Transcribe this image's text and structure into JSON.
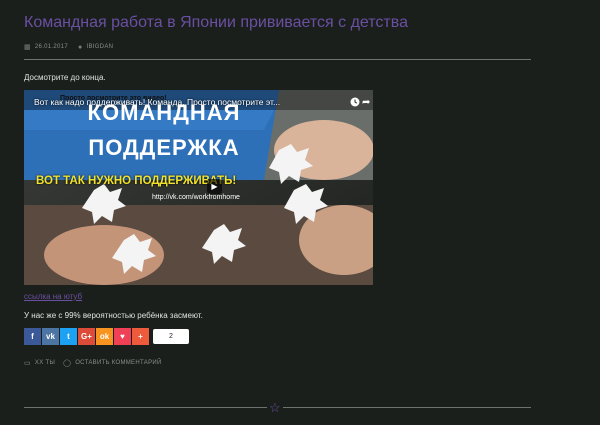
{
  "post": {
    "title": "Командная работа в Японии прививается с детства",
    "date": "26.01.2017",
    "author": "IBIGDAN",
    "intro": "Досмотрите до конца.",
    "link_text": "ссылка на ютуб",
    "stat_text": "У нас же с 99% вероятностью ребёнка засмеют.",
    "category": "ХХ ТЫ",
    "comment_link": "ОСТАВИТЬ КОММЕНТАРИЙ"
  },
  "video": {
    "title": "Вот как надо поддерживать! Команда. Просто посмотрите эт...",
    "overlay_small": "Просто посмотрите это видео!",
    "banner_line1": "КОМАНДНАЯ",
    "banner_line2": "ПОДДЕРЖКА",
    "yellow_line": "ВОТ ТАК НУЖНО ПОДДЕРЖИВАТЬ!",
    "url": "http://vk.com/workfromhome"
  },
  "share": {
    "buttons": [
      {
        "name": "facebook",
        "glyph": "f",
        "color": "#3b5998"
      },
      {
        "name": "vk",
        "glyph": "vk",
        "color": "#4c75a3"
      },
      {
        "name": "twitter",
        "glyph": "t",
        "color": "#1da1f2"
      },
      {
        "name": "google-plus",
        "glyph": "G+",
        "color": "#dd4b39"
      },
      {
        "name": "odnoklassniki",
        "glyph": "ok",
        "color": "#f7931e"
      },
      {
        "name": "pocket",
        "glyph": "♥",
        "color": "#ef4056"
      },
      {
        "name": "more",
        "glyph": "+",
        "color": "#ee5a3c"
      }
    ],
    "count": "2"
  }
}
